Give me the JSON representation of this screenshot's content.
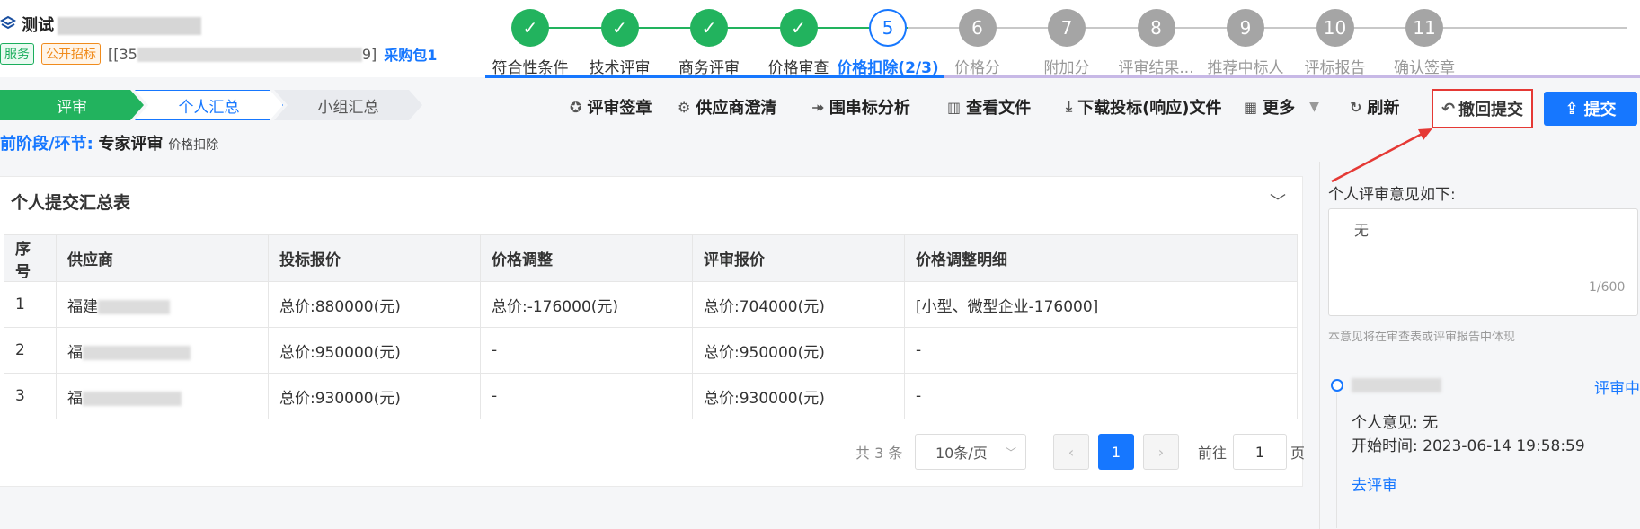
{
  "header": {
    "project_title_prefix": "测试",
    "tags": [
      "服务",
      "公开招标"
    ],
    "project_code_start": "[[35",
    "project_code_end": "9]",
    "package": "采购包1"
  },
  "steps": [
    {
      "number": "1",
      "label": "符合性条件",
      "state": "done"
    },
    {
      "number": "2",
      "label": "技术评审",
      "state": "done"
    },
    {
      "number": "3",
      "label": "商务评审",
      "state": "done"
    },
    {
      "number": "4",
      "label": "价格审查",
      "state": "done"
    },
    {
      "number": "5",
      "label": "价格扣除(2/3)",
      "state": "active"
    },
    {
      "number": "6",
      "label": "价格分",
      "state": "todo"
    },
    {
      "number": "7",
      "label": "附加分",
      "state": "todo"
    },
    {
      "number": "8",
      "label": "评审结果...",
      "state": "todo"
    },
    {
      "number": "9",
      "label": "推荐中标人",
      "state": "todo"
    },
    {
      "number": "10",
      "label": "评标报告",
      "state": "todo"
    },
    {
      "number": "11",
      "label": "确认签章",
      "state": "todo"
    }
  ],
  "breadcrumb": [
    "评审",
    "个人汇总",
    "小组汇总"
  ],
  "toolbar": {
    "sign": "评审签章",
    "clarify": "供应商澄清",
    "collusion": "围串标分析",
    "view_files": "查看文件",
    "download": "下载投标(响应)文件",
    "more": "更多",
    "refresh": "刷新",
    "withdraw": "撤回提交",
    "submit": "提交"
  },
  "stage": {
    "label": "前阶段/环节:",
    "value": "专家评审",
    "sub": "价格扣除"
  },
  "summary": {
    "title": "个人提交汇总表",
    "columns": [
      "序号",
      "供应商",
      "投标报价",
      "价格调整",
      "评审报价",
      "价格调整明细"
    ],
    "rows": [
      [
        "1",
        "福建",
        "总价:880000(元)",
        "总价:-176000(元)",
        "总价:704000(元)",
        "[小型、微型企业-176000]"
      ],
      [
        "2",
        "福",
        "总价:950000(元)",
        "-",
        "总价:950000(元)",
        "-"
      ],
      [
        "3",
        "福",
        "总价:930000(元)",
        "-",
        "总价:930000(元)",
        "-"
      ]
    ]
  },
  "pagination": {
    "total": "共 3 条",
    "page_size": "10条/页",
    "current": "1",
    "goto_label": "前往",
    "goto_value": "1",
    "page_label": "页"
  },
  "opinion": {
    "label": "个人评审意见如下:",
    "text": "无",
    "count": "1/600",
    "hint": "本意见将在审查表或评审报告中体现"
  },
  "timeline": {
    "status": "评审中",
    "opinion_label": "个人意见:",
    "opinion_value": "无",
    "start_label": "开始时间:",
    "start_value": "2023-06-14 19:58:59",
    "link": "去评审"
  },
  "colors": {
    "primary": "#1677ff",
    "success": "#22b35e",
    "highlight": "#e53935"
  }
}
